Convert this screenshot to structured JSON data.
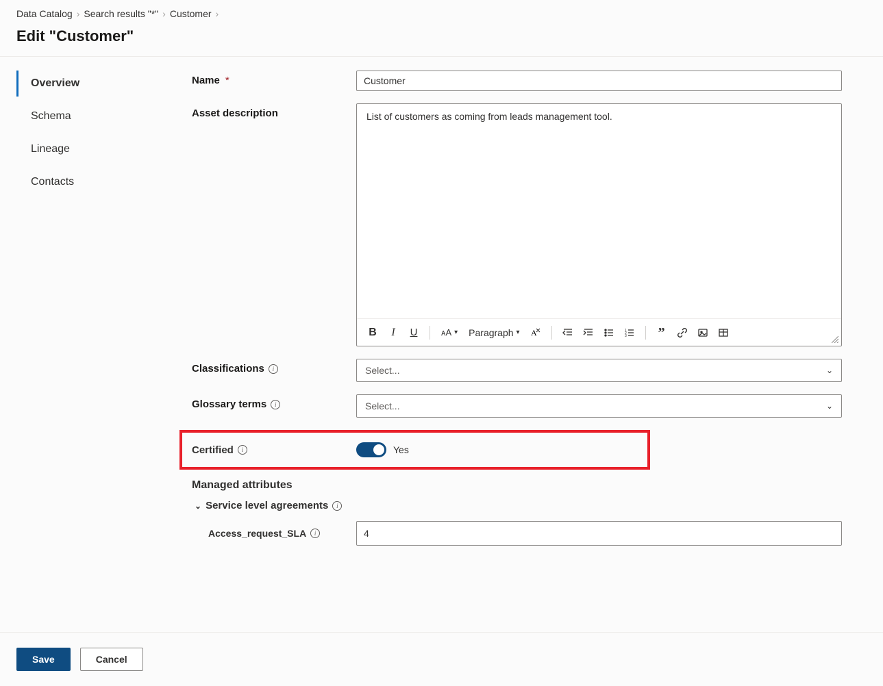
{
  "breadcrumb": {
    "items": [
      "Data Catalog",
      "Search results \"*\"",
      "Customer"
    ]
  },
  "page_title": "Edit \"Customer\"",
  "sidebar": {
    "items": [
      {
        "label": "Overview",
        "active": true
      },
      {
        "label": "Schema",
        "active": false
      },
      {
        "label": "Lineage",
        "active": false
      },
      {
        "label": "Contacts",
        "active": false
      }
    ]
  },
  "form": {
    "name": {
      "label": "Name",
      "required": true,
      "value": "Customer"
    },
    "description": {
      "label": "Asset description",
      "value": "List of customers as coming from leads management tool."
    },
    "richtext": {
      "paragraph_label": "Paragraph"
    },
    "classifications": {
      "label": "Classifications",
      "placeholder": "Select..."
    },
    "glossary": {
      "label": "Glossary terms",
      "placeholder": "Select..."
    },
    "certified": {
      "label": "Certified",
      "value_label": "Yes",
      "on": true
    },
    "managed_attributes": {
      "heading": "Managed attributes",
      "groups": [
        {
          "name": "Service level agreements",
          "attrs": [
            {
              "label": "Access_request_SLA",
              "value": "4"
            }
          ]
        }
      ]
    }
  },
  "footer": {
    "save": "Save",
    "cancel": "Cancel"
  }
}
